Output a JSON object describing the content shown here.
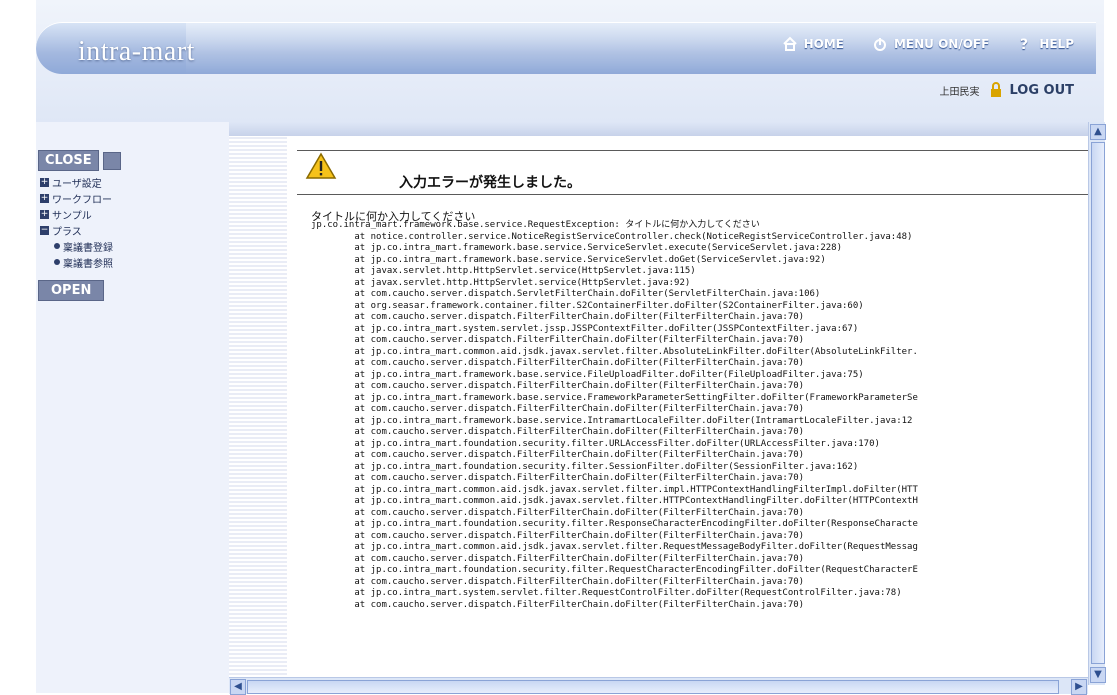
{
  "header": {
    "logo_text": "intra-mart",
    "home_label": "HOME",
    "menu_label": "MENU ON/OFF",
    "help_label": "HELP",
    "user_name": "上田民実",
    "logout_label": "LOG OUT"
  },
  "sidebar": {
    "close_label": "CLOSE",
    "open_label": "OPEN",
    "items": [
      {
        "label": "ユーザ設定"
      },
      {
        "label": "ワークフロー"
      },
      {
        "label": "サンプル"
      },
      {
        "label": "プラス"
      }
    ],
    "subitems": [
      {
        "label": "稟議書登録"
      },
      {
        "label": "稟議書参照"
      }
    ]
  },
  "content": {
    "error_title": "入力エラーが発生しました。",
    "message": "タイトルに何か入力してください",
    "trace": "jp.co.intra_mart.framework.base.service.RequestException: タイトルに何か入力してください\n        at notice.controller.service.NoticeRegistServiceController.check(NoticeRegistServiceController.java:48)\n        at jp.co.intra_mart.framework.base.service.ServiceServlet.execute(ServiceServlet.java:228)\n        at jp.co.intra_mart.framework.base.service.ServiceServlet.doGet(ServiceServlet.java:92)\n        at javax.servlet.http.HttpServlet.service(HttpServlet.java:115)\n        at javax.servlet.http.HttpServlet.service(HttpServlet.java:92)\n        at com.caucho.server.dispatch.ServletFilterChain.doFilter(ServletFilterChain.java:106)\n        at org.seasar.framework.container.filter.S2ContainerFilter.doFilter(S2ContainerFilter.java:60)\n        at com.caucho.server.dispatch.FilterFilterChain.doFilter(FilterFilterChain.java:70)\n        at jp.co.intra_mart.system.servlet.jssp.JSSPContextFilter.doFilter(JSSPContextFilter.java:67)\n        at com.caucho.server.dispatch.FilterFilterChain.doFilter(FilterFilterChain.java:70)\n        at jp.co.intra_mart.common.aid.jsdk.javax.servlet.filter.AbsoluteLinkFilter.doFilter(AbsoluteLinkFilter.\n        at com.caucho.server.dispatch.FilterFilterChain.doFilter(FilterFilterChain.java:70)\n        at jp.co.intra_mart.framework.base.service.FileUploadFilter.doFilter(FileUploadFilter.java:75)\n        at com.caucho.server.dispatch.FilterFilterChain.doFilter(FilterFilterChain.java:70)\n        at jp.co.intra_mart.framework.base.service.FrameworkParameterSettingFilter.doFilter(FrameworkParameterSe\n        at com.caucho.server.dispatch.FilterFilterChain.doFilter(FilterFilterChain.java:70)\n        at jp.co.intra_mart.framework.base.service.IntramartLocaleFilter.doFilter(IntramartLocaleFilter.java:12\n        at com.caucho.server.dispatch.FilterFilterChain.doFilter(FilterFilterChain.java:70)\n        at jp.co.intra_mart.foundation.security.filter.URLAccessFilter.doFilter(URLAccessFilter.java:170)\n        at com.caucho.server.dispatch.FilterFilterChain.doFilter(FilterFilterChain.java:70)\n        at jp.co.intra_mart.foundation.security.filter.SessionFilter.doFilter(SessionFilter.java:162)\n        at com.caucho.server.dispatch.FilterFilterChain.doFilter(FilterFilterChain.java:70)\n        at jp.co.intra_mart.common.aid.jsdk.javax.servlet.filter.impl.HTTPContextHandlingFilterImpl.doFilter(HTT\n        at jp.co.intra_mart.common.aid.jsdk.javax.servlet.filter.HTTPContextHandlingFilter.doFilter(HTTPContextH\n        at com.caucho.server.dispatch.FilterFilterChain.doFilter(FilterFilterChain.java:70)\n        at jp.co.intra_mart.foundation.security.filter.ResponseCharacterEncodingFilter.doFilter(ResponseCharacte\n        at com.caucho.server.dispatch.FilterFilterChain.doFilter(FilterFilterChain.java:70)\n        at jp.co.intra_mart.common.aid.jsdk.javax.servlet.filter.RequestMessageBodyFilter.doFilter(RequestMessag\n        at com.caucho.server.dispatch.FilterFilterChain.doFilter(FilterFilterChain.java:70)\n        at jp.co.intra_mart.foundation.security.filter.RequestCharacterEncodingFilter.doFilter(RequestCharacterE\n        at com.caucho.server.dispatch.FilterFilterChain.doFilter(FilterFilterChain.java:70)\n        at jp.co.intra_mart.system.servlet.filter.RequestControlFilter.doFilter(RequestControlFilter.java:78)\n        at com.caucho.server.dispatch.FilterFilterChain.doFilter(FilterFilterChain.java:70)"
  },
  "colors": {
    "accent": "#8fa9d8",
    "sidebar_button": "#7a86a8"
  },
  "icons": {
    "home": "home-icon",
    "power": "power-icon",
    "help": "help-icon",
    "lock": "lock-icon",
    "warning": "warning-icon"
  }
}
